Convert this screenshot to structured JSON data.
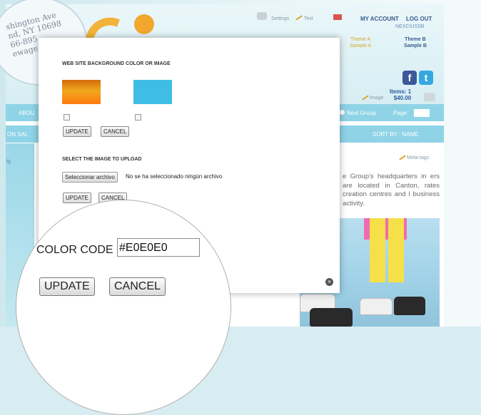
{
  "header": {
    "address_lines": [
      "shington Ave",
      "nd, NY 10698",
      "66-895",
      "ewage"
    ],
    "settings_label": "Settings",
    "text_label": "Text",
    "my_account": "MY ACCOUNT",
    "log_out": "LOG OUT",
    "username": "NEXCIUSSB",
    "theme_a": [
      "Theme A",
      "Sample A"
    ],
    "theme_b": [
      "Theme B",
      "Sample B"
    ],
    "image_label": "Image",
    "items_count": "Items: 1",
    "cart_total": "$40.00"
  },
  "nav": {
    "about": "ABOU",
    "next_group": "Next Group",
    "page_label": "Page:",
    "on_sale": "ON SAL",
    "sort_by": "SORT BY : NAME",
    "meta_tags": "Meta-tags",
    "side_fragment": "tg"
  },
  "content": {
    "paragraph": "e Group's headquarters in ers are located in Canton, rates creation centres and l business activity."
  },
  "modal": {
    "bg_title": "WEB SITE BACKGROUND COLOR OR IMAGE",
    "update_label": "UPDATE",
    "cancel_label": "CANCEL",
    "upload_title": "SELECT THE IMAGE TO UPLOAD",
    "file_button": "Seleccionar archivo",
    "file_status": "No se ha seleccionado ningún archivo",
    "close_symbol": "×"
  },
  "magnifier": {
    "color_code_label": "COLOR CODE :",
    "color_code_value": "#E0E0E0",
    "update_label": "UPDATE",
    "cancel_label": "CANCEL"
  },
  "colors": {
    "nav_blue": "#8fd3e6",
    "swatch_orange": "#f0a71c",
    "swatch_blue": "#3fbde6",
    "account_link": "#3a5a8c"
  }
}
